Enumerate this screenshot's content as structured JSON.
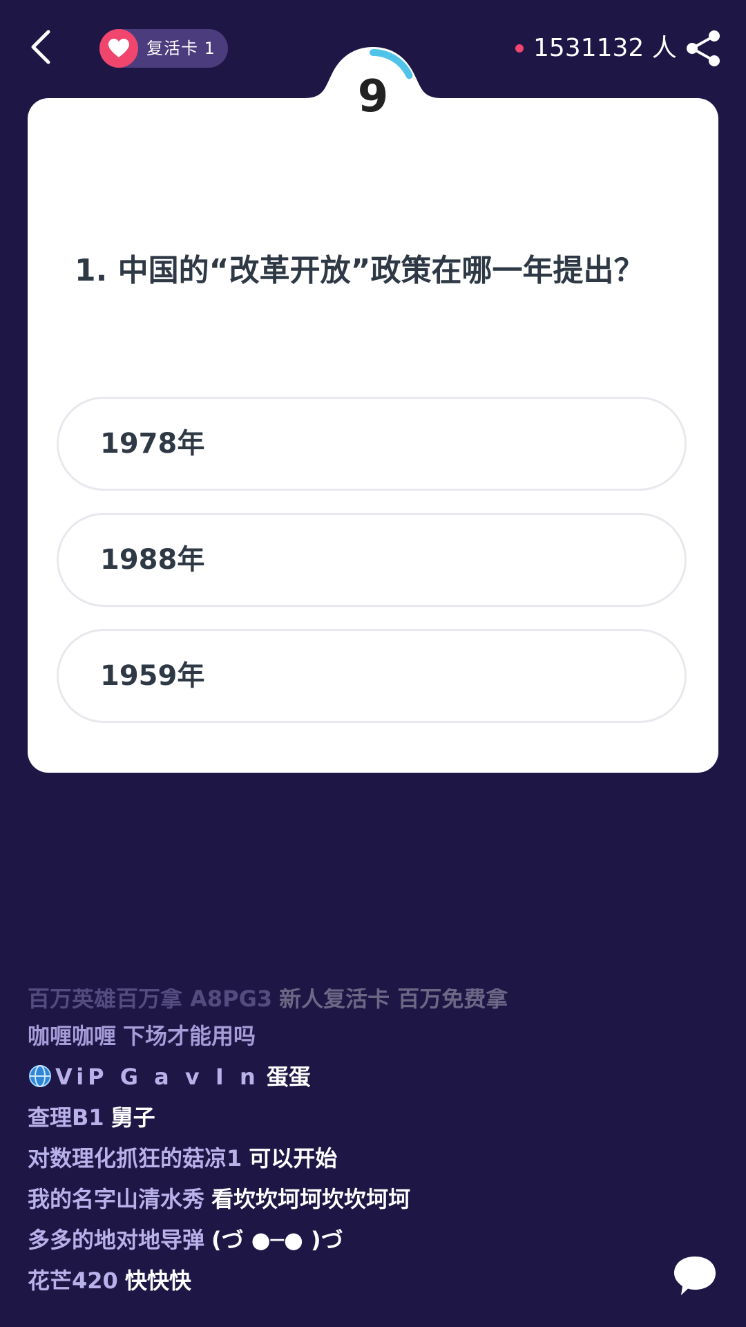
{
  "header": {
    "revive_label": "复活卡 1",
    "online_count": "1531132 人"
  },
  "quiz": {
    "timer": "9",
    "question": "1. 中国的“改革开放”政策在哪一年提出？",
    "options": [
      {
        "label": "1978年"
      },
      {
        "label": "1988年"
      },
      {
        "label": "1959年"
      }
    ],
    "timer_progress": 0.18
  },
  "comments": [
    {
      "user": "百万英雄百万拿 A8PG3",
      "message": "新人复活卡 百万免费拿"
    },
    {
      "user": "咖喱咖喱",
      "message": "下场才能用吗"
    },
    {
      "user": "ViP G a v I n",
      "message": "蛋蛋"
    },
    {
      "user": "查理B1",
      "message": "舅子"
    },
    {
      "user": "对数理化抓狂的菇凉1",
      "message": "可以开始"
    },
    {
      "user": "我的名字山清水秀",
      "message": "看坎坎坷坷坎坎坷坷"
    },
    {
      "user": "多多的地对地导弹",
      "message": "(づ ●─● )づ"
    },
    {
      "user": "花芒420",
      "message": "快快快"
    }
  ],
  "colors": {
    "background": "#1e1645",
    "accent_pink": "#f0456d",
    "timer_arc": "#4fc3e8",
    "card": "#ffffff"
  },
  "icons": [
    "back-arrow-icon",
    "heart-icon",
    "share-icon",
    "globe-icon",
    "chat-bubble-icon"
  ]
}
